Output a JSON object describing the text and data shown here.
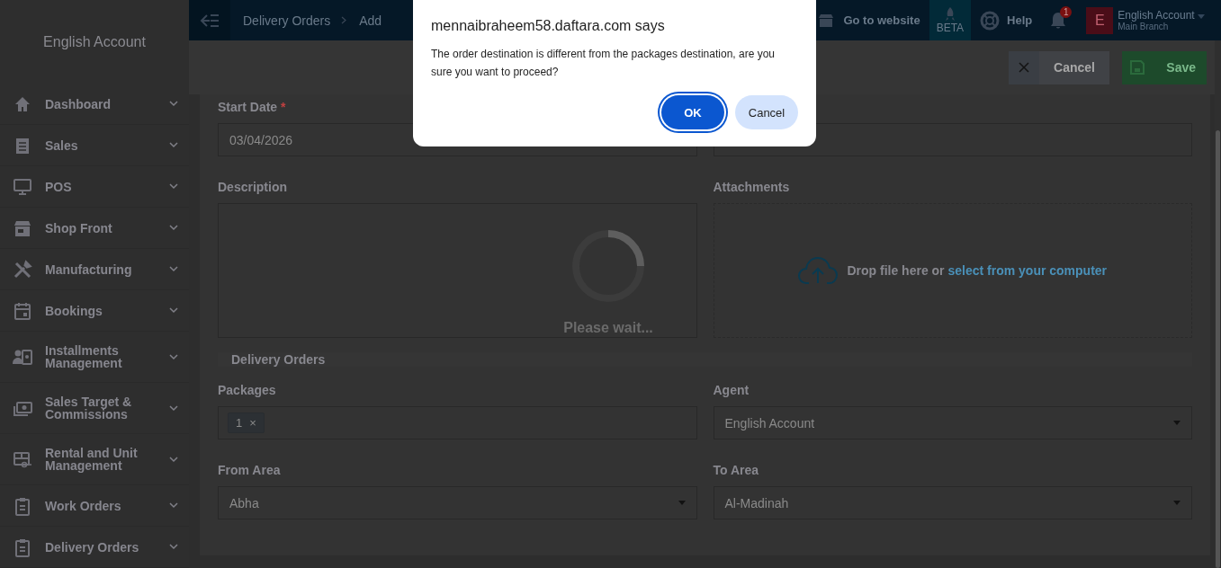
{
  "sidebar": {
    "account": "English Account",
    "items": [
      {
        "label": "Dashboard"
      },
      {
        "label": "Sales"
      },
      {
        "label": "POS"
      },
      {
        "label": "Shop Front"
      },
      {
        "label": "Manufacturing"
      },
      {
        "label": "Bookings"
      },
      {
        "label": "Installments Management"
      },
      {
        "label": "Sales Target & Commissions"
      },
      {
        "label": "Rental and Unit Management"
      },
      {
        "label": "Work Orders"
      },
      {
        "label": "Delivery Orders"
      }
    ]
  },
  "header": {
    "breadcrumbs": [
      "Delivery Orders",
      "Add"
    ],
    "website": "Go to website",
    "beta": "BETA",
    "help": "Help",
    "notifications": "1",
    "avatar": "E",
    "account": "English Account",
    "branch": "Main Branch"
  },
  "toolbar": {
    "cancel": "Cancel",
    "save": "Save"
  },
  "form": {
    "start_date": {
      "label": "Start Date",
      "required_mark": "*",
      "value": "03/04/2026"
    },
    "description": {
      "label": "Description"
    },
    "attachments": {
      "label": "Attachments",
      "drop_text": "Drop file here or",
      "link": "select from your computer"
    },
    "section": "Delivery Orders",
    "packages": {
      "label": "Packages",
      "tags": [
        {
          "label": "1",
          "remove": "×"
        }
      ]
    },
    "agent": {
      "label": "Agent",
      "value": "English Account"
    },
    "from_area": {
      "label": "From Area",
      "value": "Abha"
    },
    "to_area": {
      "label": "To Area",
      "value": "Al-Madinah"
    }
  },
  "loader": {
    "text": "Please wait..."
  },
  "dialog": {
    "title": "mennaibraheem58.daftara.com says",
    "message": "The order destination is different from the packages destination, are you sure you want to proceed?",
    "buttons": [
      {
        "label": "OK",
        "kind": "primary"
      },
      {
        "label": "Cancel",
        "kind": "secondary"
      }
    ]
  }
}
